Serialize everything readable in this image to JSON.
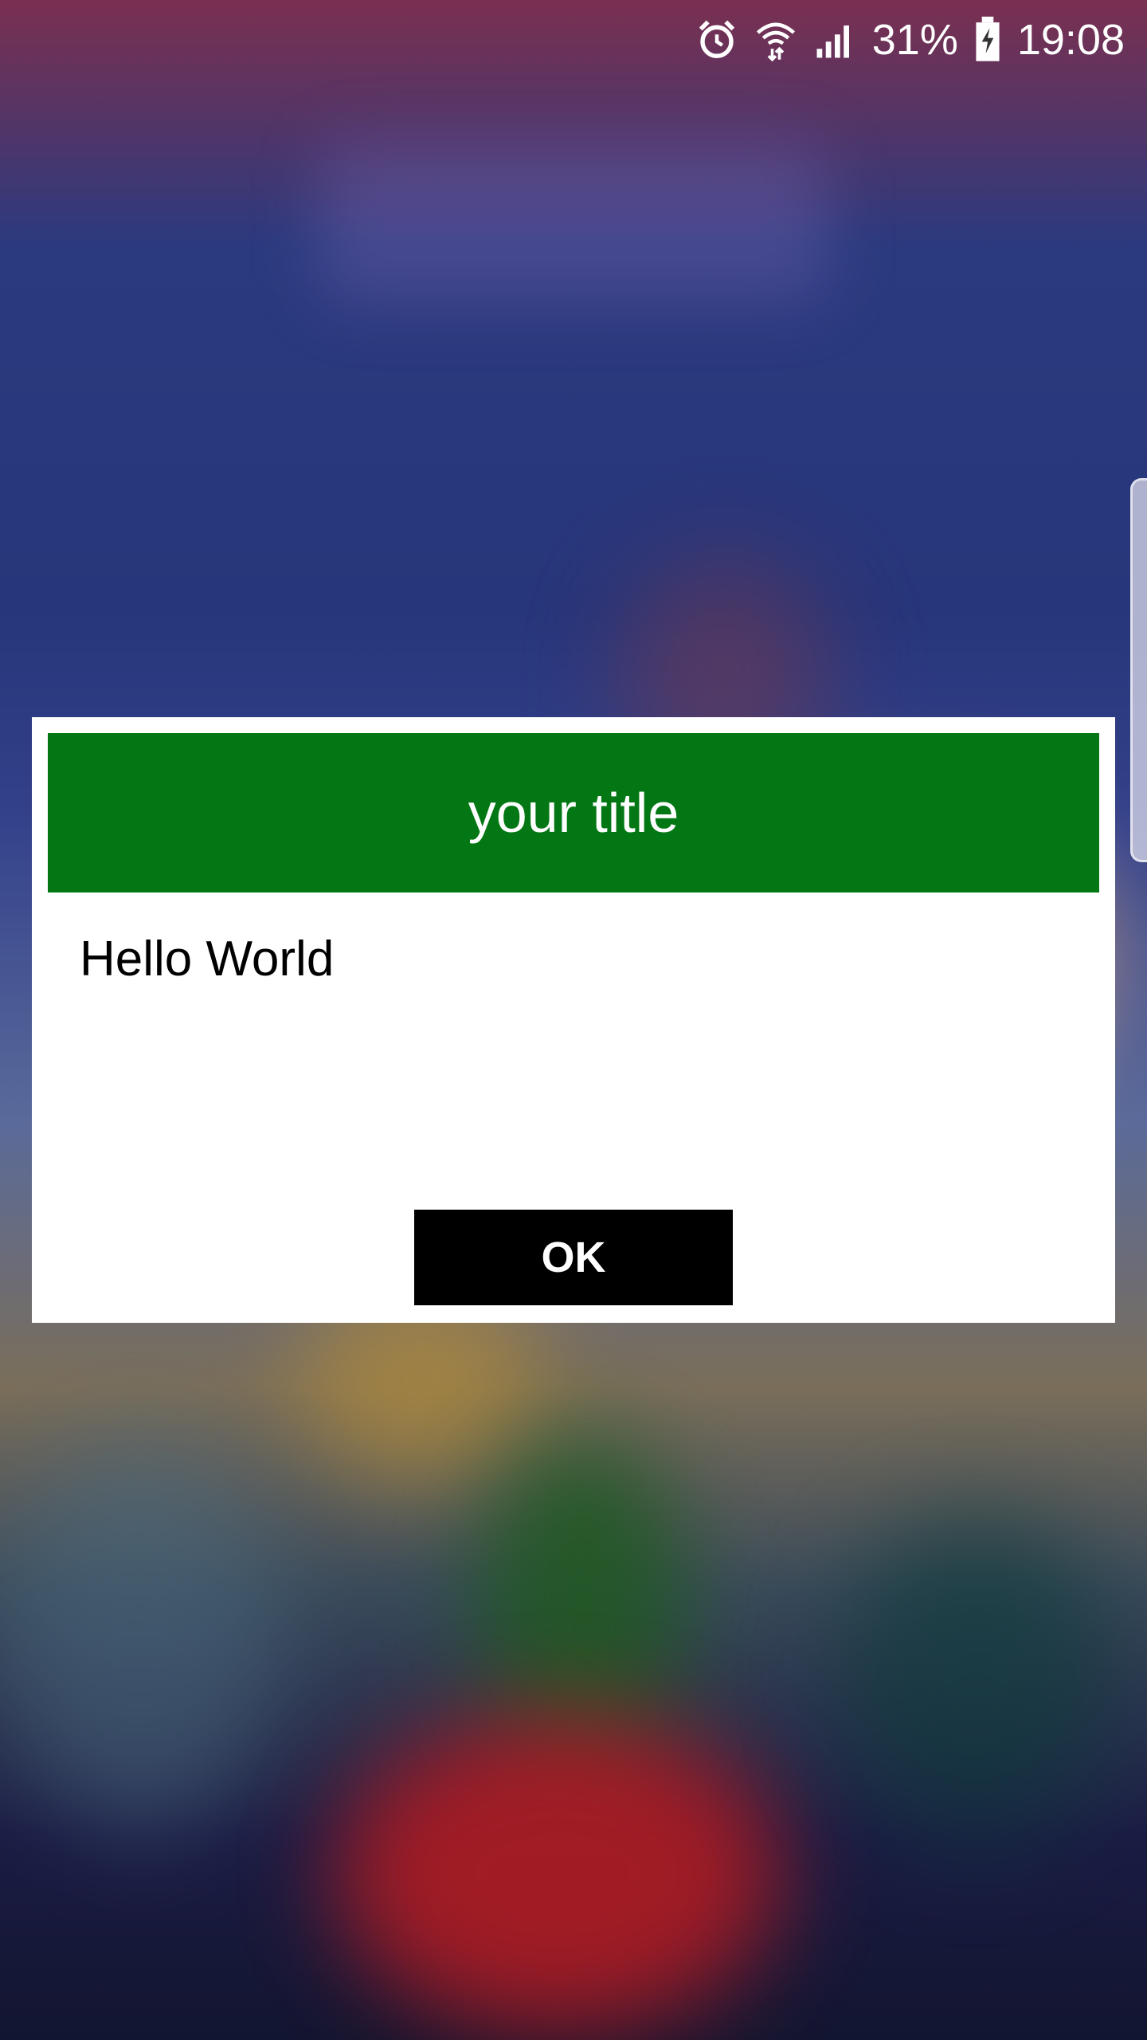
{
  "status_bar": {
    "battery_percent": "31%",
    "time": "19:08",
    "icons": [
      "alarm-icon",
      "wifi-icon",
      "signal-icon",
      "battery-charging-icon"
    ]
  },
  "dialog": {
    "title": "your title",
    "message": "Hello World",
    "ok_label": "OK"
  },
  "colors": {
    "header_bg": "#027713",
    "button_bg": "#000000",
    "dialog_bg": "#ffffff"
  }
}
